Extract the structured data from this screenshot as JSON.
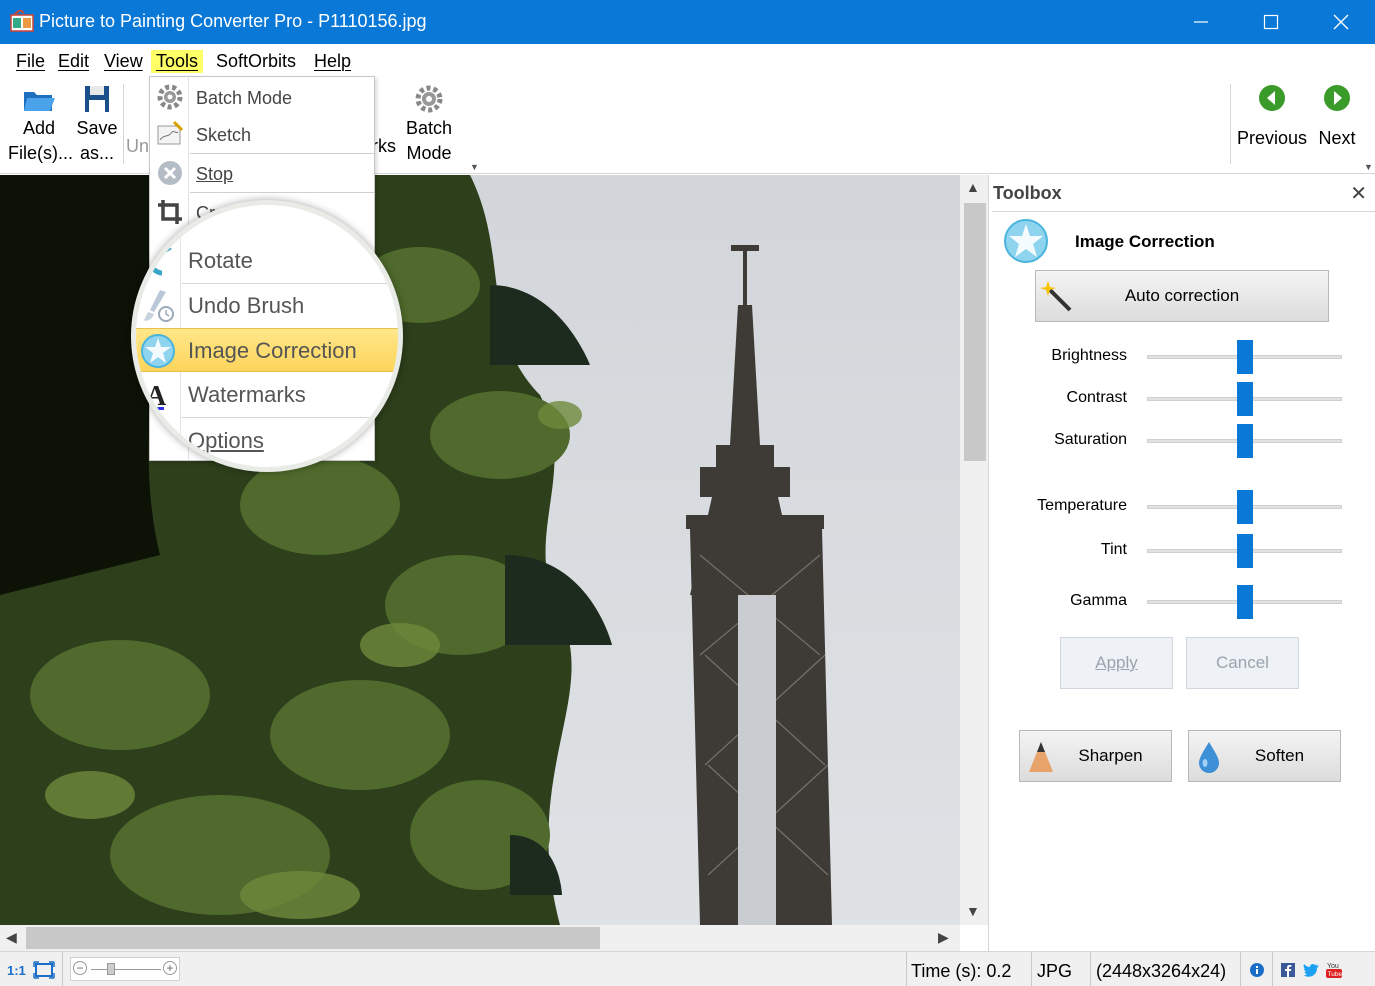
{
  "window": {
    "title": "Picture to Painting Converter Pro - P1110156.jpg",
    "accent_color": "#0a78d7"
  },
  "menu": {
    "items": [
      "File",
      "Edit",
      "View",
      "Tools",
      "SoftOrbits",
      "Help"
    ],
    "active": "Tools"
  },
  "ribbon": {
    "add_files": [
      "Add",
      "File(s)..."
    ],
    "save_as": [
      "Save",
      "as..."
    ],
    "undo_partial": "Un",
    "watermarks_partial": "rks",
    "batch_mode": [
      "Batch",
      "Mode"
    ],
    "previous": "Previous",
    "next": "Next"
  },
  "tools_menu": {
    "items": [
      {
        "label": "Batch Mode",
        "icon": "gear-icon"
      },
      {
        "label": "Sketch",
        "icon": "sketch-icon"
      },
      {
        "label": "Stop",
        "icon": "stop-icon"
      },
      {
        "label": "Crop",
        "icon": "crop-icon"
      }
    ],
    "magnified": [
      {
        "label": "Rotate",
        "icon": "rotate-icon"
      },
      {
        "label": "Undo Brush",
        "icon": "undo-brush-icon"
      },
      {
        "label": "Image Correction",
        "icon": "image-correction-icon",
        "highlighted": true
      },
      {
        "label": "Watermarks",
        "icon": "watermark-icon"
      },
      {
        "label": "Options",
        "icon": "options-icon"
      }
    ]
  },
  "toolbox": {
    "title": "Toolbox",
    "section": "Image Correction",
    "auto_correction": "Auto correction",
    "sliders": [
      {
        "label": "Brightness",
        "value": 0.5
      },
      {
        "label": "Contrast",
        "value": 0.5
      },
      {
        "label": "Saturation",
        "value": 0.5
      },
      {
        "label": "Temperature",
        "value": 0.5
      },
      {
        "label": "Tint",
        "value": 0.5
      },
      {
        "label": "Gamma",
        "value": 0.5
      }
    ],
    "apply": "Apply",
    "cancel": "Cancel",
    "sharpen": "Sharpen",
    "soften": "Soften"
  },
  "status": {
    "zoom_label": "1:1",
    "time": "Time (s): 0.2",
    "format": "JPG",
    "dimensions": "(2448x3264x24)"
  }
}
